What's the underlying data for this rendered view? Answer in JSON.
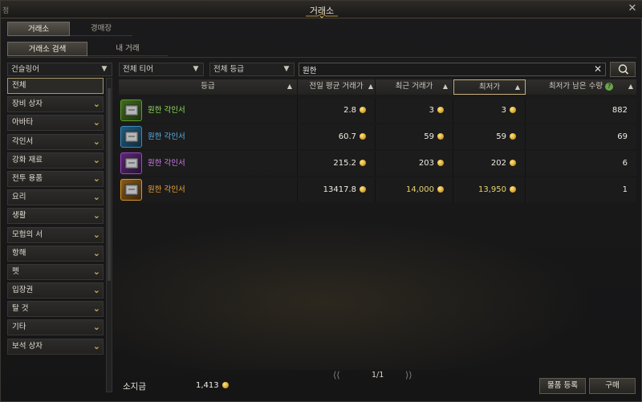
{
  "window": {
    "title": "거래소",
    "left_fragment": "정"
  },
  "tabs_top": [
    {
      "label": "거래소",
      "active": true
    },
    {
      "label": "경매장",
      "active": false
    }
  ],
  "tabs_sub": [
    {
      "label": "거래소 검색",
      "active": true
    },
    {
      "label": "내 거래",
      "active": false
    }
  ],
  "filters": {
    "class": "건슬링어",
    "tier": "전체 티어",
    "grade": "전체 등급",
    "search_value": "원한",
    "search_placeholder": ""
  },
  "categories": [
    {
      "label": "전체",
      "active": true
    },
    {
      "label": "장비 상자"
    },
    {
      "label": "아바타"
    },
    {
      "label": "각인서"
    },
    {
      "label": "강화 재료"
    },
    {
      "label": "전투 용품"
    },
    {
      "label": "요리"
    },
    {
      "label": "생활"
    },
    {
      "label": "모험의 서"
    },
    {
      "label": "항해"
    },
    {
      "label": "펫"
    },
    {
      "label": "입장권"
    },
    {
      "label": "탈 것"
    },
    {
      "label": "기타"
    },
    {
      "label": "보석 상자"
    }
  ],
  "table": {
    "headers": {
      "grade": "등급",
      "avg_price": "전일 평균 거래가",
      "recent_price": "최근 거래가",
      "lowest_price": "최저가",
      "lowest_qty": "최저가 남은 수량"
    },
    "rows": [
      {
        "name": "원한 각인서",
        "grade_color": "#7bd84a",
        "avg_price": "2.8",
        "recent_price": "3",
        "lowest_price": "3",
        "qty": "882"
      },
      {
        "name": "원한 각인서",
        "grade_color": "#4aa7e8",
        "avg_price": "60.7",
        "recent_price": "59",
        "lowest_price": "59",
        "qty": "69"
      },
      {
        "name": "원한 각인서",
        "grade_color": "#c76ae6",
        "avg_price": "215.2",
        "recent_price": "203",
        "lowest_price": "202",
        "qty": "6"
      },
      {
        "name": "원한 각인서",
        "grade_color": "#f0a030",
        "avg_price": "13417.8",
        "recent_price": "14,000",
        "lowest_price": "13,950",
        "qty": "1"
      }
    ]
  },
  "pagination": {
    "page": "1/1"
  },
  "footer": {
    "gold_label": "소지금",
    "gold_value": "1,413",
    "register_label": "물품 등록",
    "buy_label": "구매"
  },
  "colors": {
    "accent_gold": "#d8b659",
    "coin": "#d7a62a"
  }
}
